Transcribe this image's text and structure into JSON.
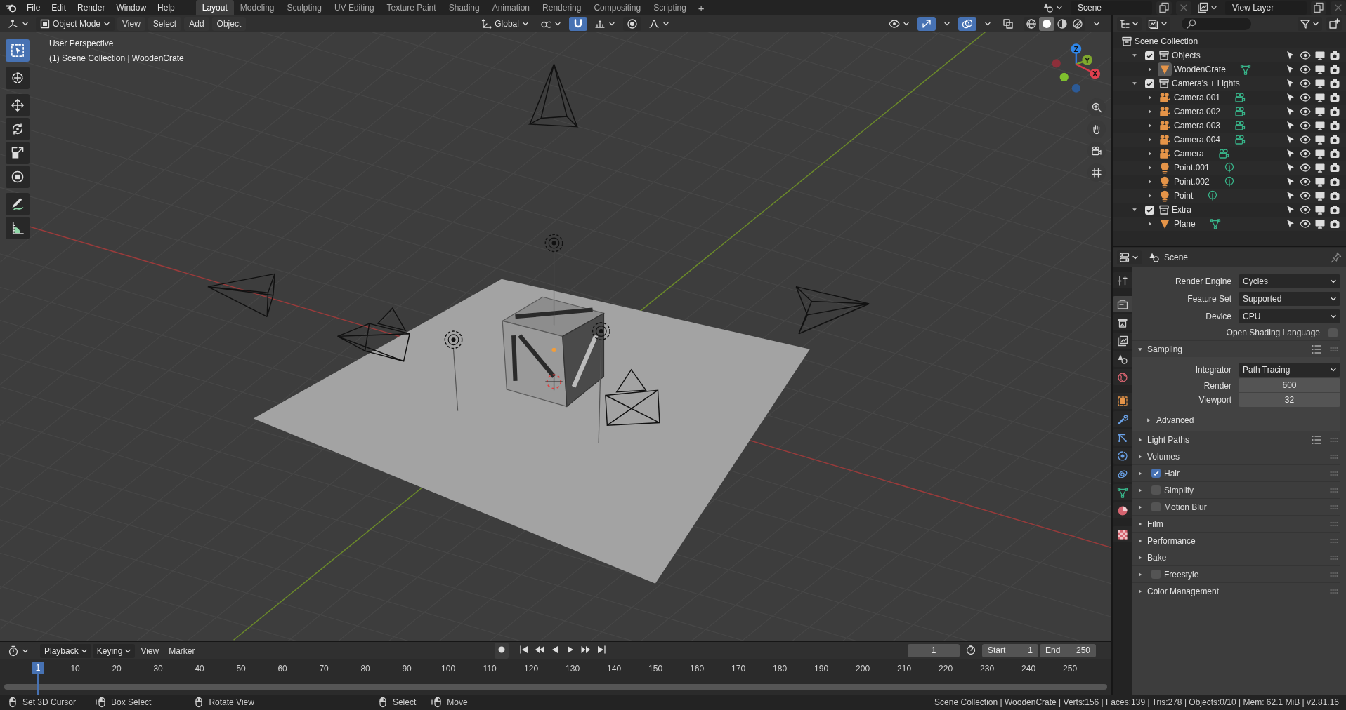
{
  "topbar": {
    "menus": [
      "File",
      "Edit",
      "Render",
      "Window",
      "Help"
    ],
    "workspaces": [
      {
        "label": "Layout",
        "selected": true
      },
      {
        "label": "Modeling",
        "selected": false
      },
      {
        "label": "Sculpting",
        "selected": false
      },
      {
        "label": "UV Editing",
        "selected": false
      },
      {
        "label": "Texture Paint",
        "selected": false
      },
      {
        "label": "Shading",
        "selected": false
      },
      {
        "label": "Animation",
        "selected": false
      },
      {
        "label": "Rendering",
        "selected": false
      },
      {
        "label": "Compositing",
        "selected": false
      },
      {
        "label": "Scripting",
        "selected": false
      }
    ],
    "add_workspace": "+",
    "scene": "Scene",
    "view_layer": "View Layer"
  },
  "viewport": {
    "mode": "Object Mode",
    "menus": [
      "View",
      "Select",
      "Add",
      "Object"
    ],
    "orientation": "Global",
    "snap_on": true,
    "gizmos_on": true,
    "overlays_on": true,
    "shading": [
      {
        "kind": "wireframe",
        "selected": false
      },
      {
        "kind": "solid",
        "selected": true
      },
      {
        "kind": "material",
        "selected": false
      },
      {
        "kind": "rendered",
        "selected": false
      }
    ],
    "view_name": "User Perspective",
    "context": "(1) Scene Collection | WoodenCrate",
    "gizmo_axes": [
      "Z",
      "Y",
      "X"
    ],
    "tools": [
      {
        "kind": "select_box",
        "selected": true
      },
      {
        "kind": "cursor",
        "selected": false
      },
      {
        "kind": "move",
        "selected": false
      },
      {
        "kind": "rotate",
        "selected": false
      },
      {
        "kind": "scale",
        "selected": false
      },
      {
        "kind": "transform",
        "selected": false
      },
      {
        "kind": "annotate",
        "selected": false
      },
      {
        "kind": "measure",
        "selected": false
      }
    ]
  },
  "outliner": {
    "root": "Scene Collection",
    "tree": [
      {
        "kind": "collection",
        "label": "Objects",
        "checked": true,
        "expanded": true,
        "children": [
          {
            "kind": "mesh",
            "label": "WoodenCrate",
            "active": true,
            "expanded": false
          }
        ]
      },
      {
        "kind": "collection",
        "label": "Camera's + Lights",
        "checked": true,
        "expanded": true,
        "children": [
          {
            "kind": "camera",
            "label": "Camera.001",
            "active": false,
            "expanded": false
          },
          {
            "kind": "camera",
            "label": "Camera.002",
            "active": false,
            "expanded": false
          },
          {
            "kind": "camera",
            "label": "Camera.003",
            "active": false,
            "expanded": false
          },
          {
            "kind": "camera",
            "label": "Camera.004",
            "active": false,
            "expanded": false
          },
          {
            "kind": "camera",
            "label": "Camera",
            "active": false,
            "expanded": false
          },
          {
            "kind": "light",
            "label": "Point.001",
            "active": false,
            "expanded": false
          },
          {
            "kind": "light",
            "label": "Point.002",
            "active": false,
            "expanded": false
          },
          {
            "kind": "light",
            "label": "Point",
            "active": false,
            "expanded": false
          }
        ]
      },
      {
        "kind": "collection",
        "label": "Extra",
        "checked": true,
        "expanded": true,
        "children": [
          {
            "kind": "mesh",
            "label": "Plane",
            "active": false,
            "expanded": false
          }
        ]
      }
    ]
  },
  "properties": {
    "context": "Scene",
    "tabs": [
      {
        "kind": "tool",
        "selected": false
      },
      {
        "kind": "render",
        "selected": true
      },
      {
        "kind": "output",
        "selected": false
      },
      {
        "kind": "view_layer",
        "selected": false
      },
      {
        "kind": "scene",
        "selected": false
      },
      {
        "kind": "world",
        "selected": false
      },
      {
        "kind": "object",
        "selected": false
      },
      {
        "kind": "modifiers",
        "selected": false
      },
      {
        "kind": "particles",
        "selected": false
      },
      {
        "kind": "physics",
        "selected": false
      },
      {
        "kind": "constraints",
        "selected": false
      },
      {
        "kind": "data",
        "selected": false
      },
      {
        "kind": "material",
        "selected": false
      },
      {
        "kind": "texture",
        "selected": false
      }
    ],
    "fields": [
      {
        "kind": "dropdown",
        "label": "Render Engine",
        "value": "Cycles"
      },
      {
        "kind": "dropdown",
        "label": "Feature Set",
        "value": "Supported"
      },
      {
        "kind": "dropdown",
        "label": "Device",
        "value": "CPU"
      },
      {
        "kind": "checkbox",
        "label": "Open Shading Language",
        "checked": false
      }
    ],
    "panels": [
      {
        "label": "Sampling",
        "expanded": true,
        "presets": true,
        "fields": [
          {
            "kind": "dropdown",
            "label": "Integrator",
            "value": "Path Tracing"
          },
          {
            "kind": "number",
            "label": "Render",
            "value": "600"
          },
          {
            "kind": "number",
            "label": "Viewport",
            "value": "32"
          }
        ],
        "subpanels": [
          {
            "label": "Advanced",
            "expanded": false
          }
        ]
      },
      {
        "label": "Light Paths",
        "expanded": false,
        "presets": true
      },
      {
        "label": "Volumes",
        "expanded": false,
        "presets": false
      },
      {
        "label": "Hair",
        "expanded": false,
        "presets": false,
        "checked": true
      },
      {
        "label": "Simplify",
        "expanded": false,
        "presets": false,
        "checked": false
      },
      {
        "label": "Motion Blur",
        "expanded": false,
        "presets": false,
        "checked": false
      },
      {
        "label": "Film",
        "expanded": false,
        "presets": false
      },
      {
        "label": "Performance",
        "expanded": false,
        "presets": false
      },
      {
        "label": "Bake",
        "expanded": false,
        "presets": false
      },
      {
        "label": "Freestyle",
        "expanded": false,
        "presets": false,
        "checked": false
      },
      {
        "label": "Color Management",
        "expanded": false,
        "presets": false
      }
    ]
  },
  "timeline": {
    "menus": [
      "Playback",
      "Keying",
      "View",
      "Marker"
    ],
    "playhead": "1",
    "current_frame": "1",
    "start_label": "Start",
    "start": "1",
    "end_label": "End",
    "end": "250",
    "ruler": [
      "10",
      "20",
      "30",
      "40",
      "50",
      "60",
      "70",
      "80",
      "90",
      "100",
      "110",
      "120",
      "130",
      "140",
      "150",
      "160",
      "170",
      "180",
      "190",
      "200",
      "210",
      "220",
      "230",
      "240",
      "250"
    ]
  },
  "statusbar": {
    "hints": [
      {
        "kind": "left",
        "label": "Set 3D Cursor"
      },
      {
        "kind": "drag",
        "label": "Box Select"
      },
      {
        "kind": "middle",
        "label": "Rotate View"
      },
      {
        "kind": "left",
        "label": "Select"
      },
      {
        "kind": "drag",
        "label": "Move"
      }
    ],
    "stats": "Scene Collection | WoodenCrate | Verts:156 | Faces:139 | Tris:278 | Objects:0/10 | Mem: 62.1 MiB | v2.81.16"
  }
}
